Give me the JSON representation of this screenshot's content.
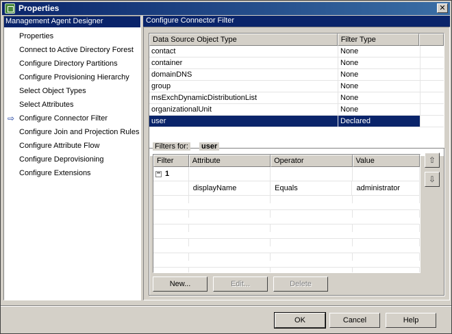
{
  "window": {
    "title": "Properties",
    "close_label": "✕"
  },
  "left_panel": {
    "header": "Management Agent Designer",
    "items": [
      {
        "label": "Properties",
        "active": false
      },
      {
        "label": "Connect to Active Directory Forest",
        "active": false
      },
      {
        "label": "Configure Directory Partitions",
        "active": false
      },
      {
        "label": "Configure Provisioning Hierarchy",
        "active": false
      },
      {
        "label": "Select Object Types",
        "active": false
      },
      {
        "label": "Select Attributes",
        "active": false
      },
      {
        "label": "Configure Connector Filter",
        "active": true
      },
      {
        "label": "Configure Join and Projection Rules",
        "active": false
      },
      {
        "label": "Configure Attribute Flow",
        "active": false
      },
      {
        "label": "Configure Deprovisioning",
        "active": false
      },
      {
        "label": "Configure Extensions",
        "active": false
      }
    ],
    "active_arrow": "⇨"
  },
  "right_panel": {
    "header": "Configure Connector Filter",
    "object_grid": {
      "columns": [
        "Data Source Object Type",
        "Filter Type"
      ],
      "rows": [
        [
          "contact",
          "None"
        ],
        [
          "container",
          "None"
        ],
        [
          "domainDNS",
          "None"
        ],
        [
          "group",
          "None"
        ],
        [
          "msExchDynamicDistributionList",
          "None"
        ],
        [
          "organizationalUnit",
          "None"
        ],
        [
          "user",
          "Declared"
        ]
      ],
      "selected_row": "user"
    },
    "filters": {
      "label": "Filters for:",
      "object": "user",
      "columns": [
        "Filter",
        "Attribute",
        "Operator",
        "Value"
      ],
      "group_id": "1",
      "expander": "−",
      "conditions": [
        {
          "attribute": "displayName",
          "operator": "Equals",
          "value": "administrator"
        }
      ],
      "buttons": {
        "new": "New...",
        "edit": "Edit...",
        "delete": "Delete"
      },
      "move_up": "⇧",
      "move_down": "⇩"
    }
  },
  "footer": {
    "ok": "OK",
    "cancel": "Cancel",
    "help": "Help"
  },
  "colors": {
    "selection": "#0a246a",
    "face": "#d4d0c8"
  }
}
